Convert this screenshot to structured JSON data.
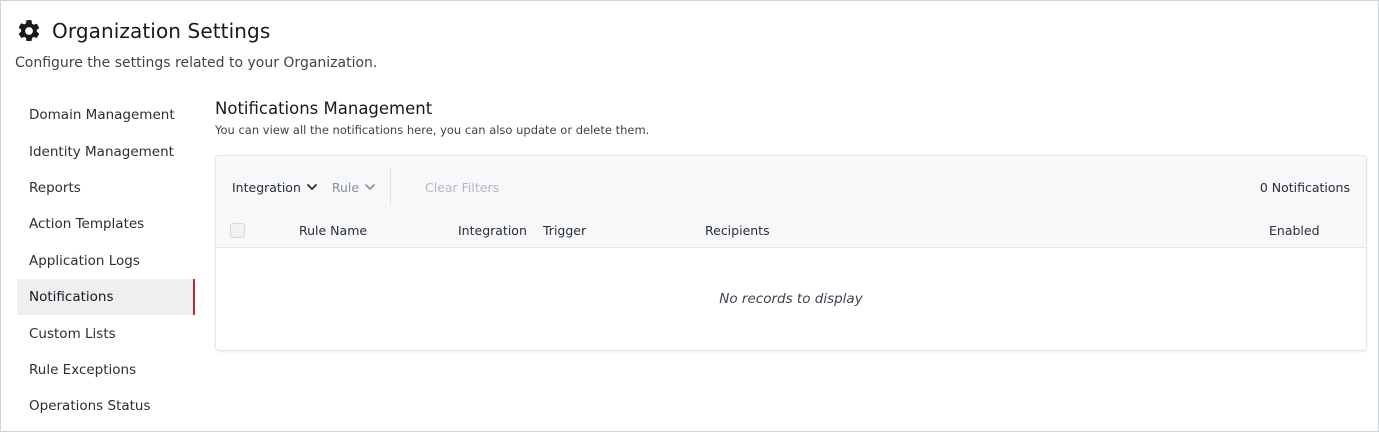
{
  "header": {
    "icon": "gear-icon",
    "title": "Organization Settings",
    "subtitle": "Configure the settings related to your Organization."
  },
  "sidebar": {
    "active_index": 5,
    "accent_color": "#c0283a",
    "items": [
      {
        "label": "Domain Management"
      },
      {
        "label": "Identity Management"
      },
      {
        "label": "Reports"
      },
      {
        "label": "Action Templates"
      },
      {
        "label": "Application Logs"
      },
      {
        "label": "Notifications"
      },
      {
        "label": "Custom Lists"
      },
      {
        "label": "Rule Exceptions"
      },
      {
        "label": "Operations Status"
      }
    ]
  },
  "main": {
    "title": "Notifications Management",
    "description": "You can view all the notifications here, you can also update or delete them.",
    "filters": {
      "integration_label": "Integration",
      "rule_label": "Rule",
      "clear_label": "Clear Filters",
      "count_label": "0 Notifications"
    },
    "table": {
      "columns": [
        "Rule Name",
        "Integration",
        "Trigger",
        "Recipients",
        "Enabled"
      ],
      "rows": [],
      "empty_message": "No records to display"
    }
  }
}
